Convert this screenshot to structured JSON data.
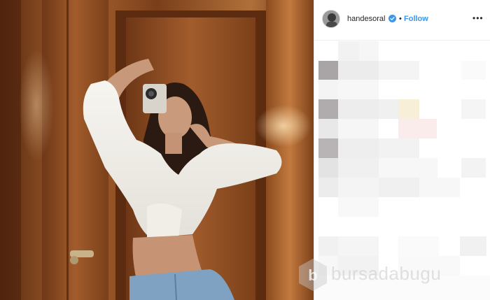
{
  "post": {
    "username": "handesoral",
    "follow_label": "Follow",
    "separator": "•",
    "more_label": "•••",
    "verified": true
  },
  "watermark": {
    "text": "bursadabugu"
  },
  "colors": {
    "follow_blue": "#3897f0",
    "verified_blue": "#3897f0",
    "text": "#262626"
  },
  "icons": {
    "verified": "verified-badge-icon",
    "more": "more-options-icon"
  }
}
